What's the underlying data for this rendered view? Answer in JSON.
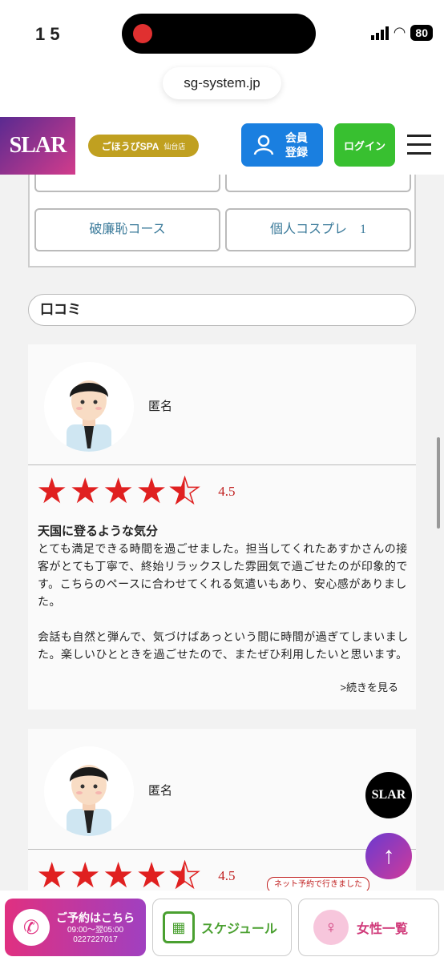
{
  "status": {
    "time": "1 5",
    "battery": "80"
  },
  "browser": {
    "url": "sg-system.jp"
  },
  "header": {
    "logo": "SLAR",
    "shop": {
      "name": "ごほうびSPA",
      "branch": "仙台店"
    },
    "register": {
      "line1": "会員",
      "line2": "登録"
    },
    "login": "ログイン"
  },
  "courses": [
    {
      "label": "破廉恥コース"
    },
    {
      "label": "個人コスプレ　1"
    }
  ],
  "reviews_label": "口コミ",
  "reviews": [
    {
      "name": "匿名",
      "rating": 4.5,
      "score": "4.5",
      "title": "天国に登るような気分",
      "body": "とても満足できる時間を過ごせました。担当してくれたあすかさんの接客がとても丁寧で、終始リラックスした雰囲気で過ごせたのが印象的です。こちらのペースに合わせてくれる気遣いもあり、安心感がありました。\n\n会話も自然と弾んで、気づけばあっという間に時間が過ぎてしまいました。楽しいひとときを過ごせたので、またぜひ利用したいと思います。",
      "more": ">続きを見る"
    },
    {
      "name": "匿名",
      "rating": 4.5,
      "score": "4.5",
      "tag": "ネット予約で行きました"
    }
  ],
  "float": {
    "logo": "SLAR"
  },
  "bottom": {
    "reserve": {
      "label": "ご予約はこちら",
      "hours": "09:00～翌05:00",
      "phone": "0227227017"
    },
    "schedule": "スケジュール",
    "girls": "女性一覧"
  }
}
